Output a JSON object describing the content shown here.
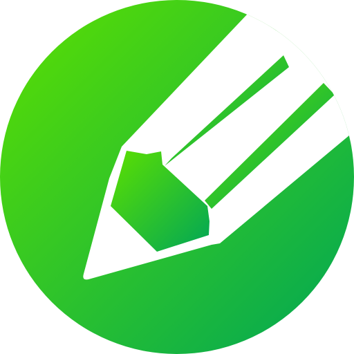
{
  "icon": {
    "name": "pencil-icon",
    "shape": "circle",
    "colors": {
      "gradient_start": "#5ce000",
      "gradient_end": "#00a656",
      "pencil": "#ffffff"
    }
  }
}
